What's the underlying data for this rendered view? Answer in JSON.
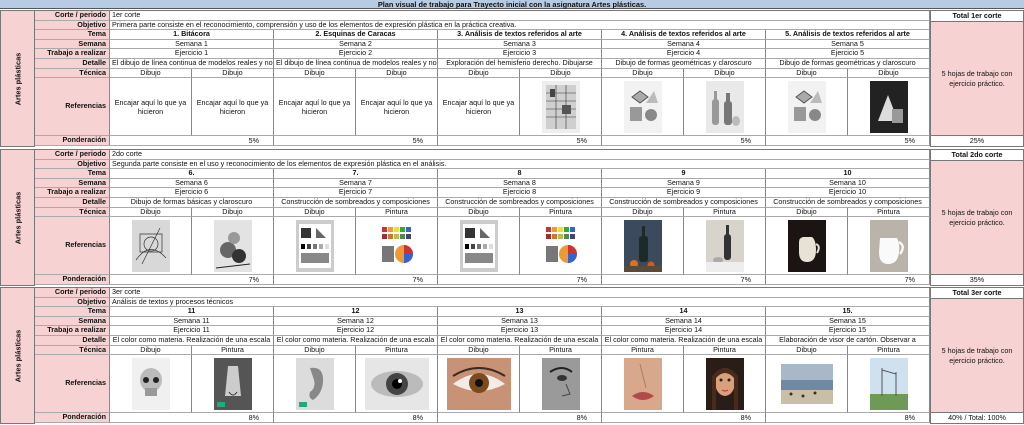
{
  "title": "Plan visual de trabajo para Trayecto inicial con la asignatura Artes plásticas.",
  "row_labels": {
    "corte": "Corte / periodo",
    "objetivo": "Objetivo",
    "tema": "Tema",
    "semana": "Semana",
    "trabajo": "Trabajo a realizar",
    "detalle": "Detalle",
    "tecnica": "Técnica",
    "referencias": "Referencias",
    "ponderacion": "Ponderación"
  },
  "side_label": "Artes plásticas",
  "bands": [
    {
      "corte": "1er corte",
      "objetivo": "Primera parte consiste en el reconocimiento, comprensión y uso de los elementos de expresión plástica en la práctica creativa.",
      "total_head": "Total 1er corte",
      "total_body": "5 hojas de trabajo con ejercicio práctico.",
      "total_foot": "25%",
      "weeks": [
        {
          "tema": "1. Bitácora",
          "semana": "Semana 1",
          "trabajo": "Ejercicio 1",
          "detalle": "El dibujo de línea continua de modelos reales y no",
          "tecnicas": [
            "Dibujo",
            "Dibujo"
          ],
          "refs": [
            {
              "text": "Encajar aquí lo que ya hicieron"
            },
            {
              "text": "Encajar aquí lo que ya hicieron"
            }
          ],
          "pond": "5%"
        },
        {
          "tema": "2. Esquinas de Caracas",
          "semana": "Semana 2",
          "trabajo": "Ejercicio 2",
          "detalle": "El dibujo de línea continua de modelos reales y no",
          "tecnicas": [
            "Dibujo",
            "Dibujo"
          ],
          "refs": [
            {
              "text": "Encajar aquí lo que ya hicieron"
            },
            {
              "text": "Encajar aquí lo que ya hicieron"
            }
          ],
          "pond": "5%"
        },
        {
          "tema": "3. Análisis de textos referidos al arte",
          "semana": "Semana 3",
          "trabajo": "Ejercicio 3",
          "detalle": "Exploración del hemisferio derecho. Dibujarse",
          "tecnicas": [
            "Dibujo",
            "Dibujo"
          ],
          "refs": [
            {
              "text": "Encajar aquí lo que ya hicieron"
            },
            {
              "img": "grid-study"
            }
          ],
          "pond": "5%"
        },
        {
          "tema": "4. Análisis de textos referidos al arte",
          "semana": "Semana 4",
          "trabajo": "Ejercicio 4",
          "detalle": "Dibujo de formas geométricas y claroscuro",
          "tecnicas": [
            "Dibujo",
            "Dibujo"
          ],
          "refs": [
            {
              "img": "geo-shapes"
            },
            {
              "img": "bottles"
            }
          ],
          "pond": "5%"
        },
        {
          "tema": "5. Análisis de textos referidos al arte",
          "semana": "Semana 5",
          "trabajo": "Ejercicio 5",
          "detalle": "Dibujo de formas geométricas y claroscuro",
          "tecnicas": [
            "Dibujo",
            "Dibujo"
          ],
          "refs": [
            {
              "img": "geo-shapes"
            },
            {
              "img": "geo-dark"
            }
          ],
          "pond": "5%"
        }
      ]
    },
    {
      "corte": "2do corte",
      "objetivo": "Segunda parte consiste en el uso y reconocimiento de los elementos de expresión plástica en el análisis.",
      "total_head": "Total 2do corte",
      "total_body": "5 hojas de trabajo con ejercicio práctico.",
      "total_foot": "35%",
      "weeks": [
        {
          "tema": "6.",
          "semana": "Semana 6",
          "trabajo": "Ejercicio 6",
          "detalle": "Dibujo de formas básicas y claroscuro",
          "tecnicas": [
            "Dibujo",
            "Dibujo"
          ],
          "refs": [
            {
              "img": "sketch"
            },
            {
              "img": "sketch-fruit"
            }
          ],
          "pond": "7%"
        },
        {
          "tema": "7.",
          "semana": "Semana 7",
          "trabajo": "Ejercicio 7",
          "detalle": "Construcción de sombreados y composiciones",
          "tecnicas": [
            "Dibujo",
            "Pintura"
          ],
          "refs": [
            {
              "img": "shading"
            },
            {
              "img": "color-chart"
            }
          ],
          "pond": "7%"
        },
        {
          "tema": "8",
          "semana": "Semana 8",
          "trabajo": "Ejercicio 8",
          "detalle": "Construcción de sombreados y composiciones",
          "tecnicas": [
            "Dibujo",
            "Pintura"
          ],
          "refs": [
            {
              "img": "shading"
            },
            {
              "img": "color-chart"
            }
          ],
          "pond": "7%"
        },
        {
          "tema": "9",
          "semana": "Semana 9",
          "trabajo": "Ejercicio 9",
          "detalle": "Construcción de sombreados y composiciones",
          "tecnicas": [
            "Dibujo",
            "Pintura"
          ],
          "refs": [
            {
              "img": "bottle-still"
            },
            {
              "img": "bottle-light"
            }
          ],
          "pond": "7%"
        },
        {
          "tema": "10",
          "semana": "Semana 10",
          "trabajo": "Ejercicio 10",
          "detalle": "Construcción de sombreados y composiciones",
          "tecnicas": [
            "Dibujo",
            "Pintura"
          ],
          "refs": [
            {
              "img": "jug-dark"
            },
            {
              "img": "jug-white"
            }
          ],
          "pond": "7%"
        }
      ]
    },
    {
      "corte": "3er corte",
      "objetivo": "Análisis de textos y procesos técnicos",
      "total_head": "Total 3er corte",
      "total_body": "5 hojas de trabajo con ejercicio práctico.",
      "total_foot": "40% / Total: 100%",
      "weeks": [
        {
          "tema": "11",
          "semana": "Semana 11",
          "trabajo": "Ejercicio 11",
          "detalle": "El color como materia. Realización de una escala",
          "tecnicas": [
            "Dibujo",
            "Pintura"
          ],
          "refs": [
            {
              "img": "skull"
            },
            {
              "img": "nose"
            }
          ],
          "pond": "8%"
        },
        {
          "tema": "12",
          "semana": "Semana 12",
          "trabajo": "Ejercicio 12",
          "detalle": "El color como materia. Realización de una escala",
          "tecnicas": [
            "Dibujo",
            "Pintura"
          ],
          "refs": [
            {
              "img": "ear"
            },
            {
              "img": "eye-bw"
            }
          ],
          "pond": "8%"
        },
        {
          "tema": "13",
          "semana": "Semana 13",
          "trabajo": "Ejercicio 13",
          "detalle": "El color como materia. Realización de una escala",
          "tecnicas": [
            "Dibujo",
            "Pintura"
          ],
          "refs": [
            {
              "img": "eye-color"
            },
            {
              "img": "face-gray"
            }
          ],
          "pond": "8%"
        },
        {
          "tema": "14",
          "semana": "Semana 14",
          "trabajo": "Ejercicio 14",
          "detalle": "El color como materia. Realización de una escala",
          "tecnicas": [
            "Pintura",
            "Pintura"
          ],
          "refs": [
            {
              "img": "lips"
            },
            {
              "img": "portrait"
            }
          ],
          "pond": "8%"
        },
        {
          "tema": "15.",
          "semana": "Semana 15",
          "trabajo": "Ejercicio 15",
          "detalle": "Elaboración de visor de cartón. Observar a",
          "tecnicas": [
            "Dibujo",
            "Pintura"
          ],
          "refs": [
            {
              "img": "beach"
            },
            {
              "img": "field"
            }
          ],
          "pond": "8%"
        }
      ]
    }
  ],
  "colors": {
    "title_bg": "#b7cbe4",
    "label_bg": "#f7d2d2",
    "border": "#777777"
  }
}
